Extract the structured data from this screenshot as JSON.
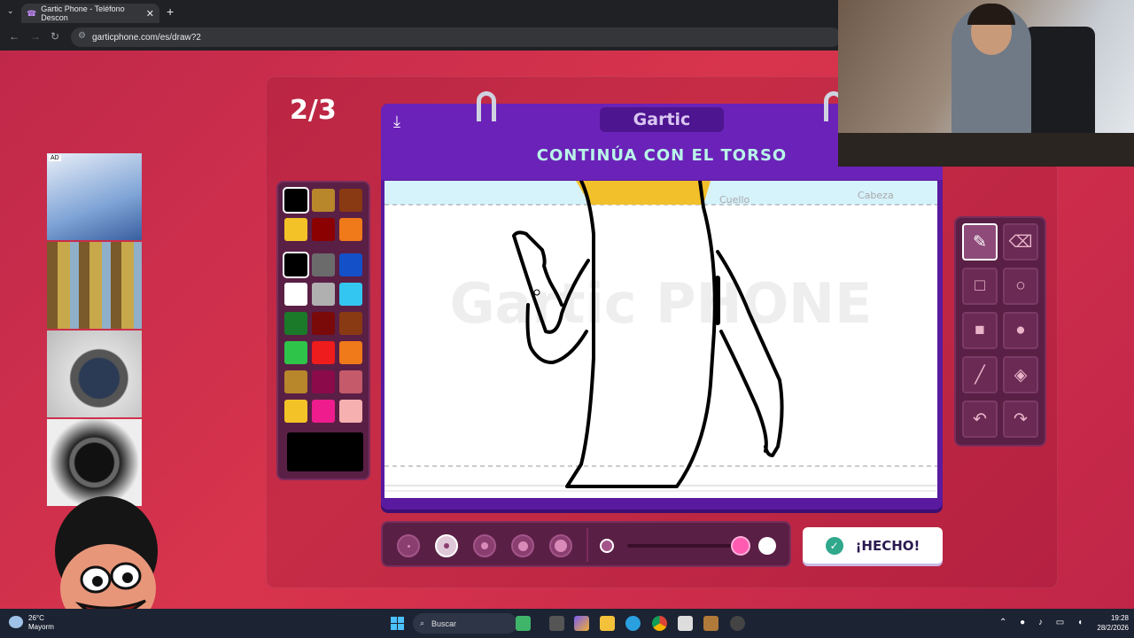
{
  "browser": {
    "tab_title": "Gartic Phone - Teléfono Descon",
    "url": "garticphone.com/es/draw?2"
  },
  "game": {
    "round": "2/3",
    "logo": "Gartic",
    "prompt": "CONTINÚA CON EL TORSO",
    "canvas_watermark": "Gartic PHONE",
    "canvas_notes": [
      "Cuello",
      "Cabeza"
    ],
    "done_label": "¡HECHO!",
    "palette": {
      "rows": [
        [
          "#000000",
          "#b8862b",
          "#8a3a12"
        ],
        [
          "#f3c226",
          "#8b0000",
          "#f07a1a"
        ],
        [
          "#000000",
          "#6b6b6b",
          "#1450c8"
        ],
        [
          "#ffffff",
          "#b0b0b0",
          "#33c6f0"
        ],
        [
          "#1a7a2a",
          "#7a0a0a",
          "#8a3a12"
        ],
        [
          "#2ec44a",
          "#ee1c1c",
          "#f07a1a"
        ],
        [
          "#b8862b",
          "#8a0a4a",
          "#c45a6a"
        ],
        [
          "#f3c226",
          "#ee1c8c",
          "#f6b0b0"
        ]
      ],
      "current": "#000000"
    },
    "tools": [
      "pencil-icon",
      "eraser-icon",
      "rectangle-outline-icon",
      "ellipse-outline-icon",
      "rectangle-fill-icon",
      "ellipse-fill-icon",
      "line-icon",
      "bucket-icon",
      "undo-icon",
      "redo-icon"
    ],
    "active_tool": "pencil-icon",
    "brush_sizes_count": 5,
    "selected_size_index": 1,
    "opacity_level": 1.0
  },
  "taskbar": {
    "temp": "26°C",
    "weather": "Mayorm",
    "search": "Buscar",
    "time": "19:28",
    "date": "28/2/2026"
  }
}
